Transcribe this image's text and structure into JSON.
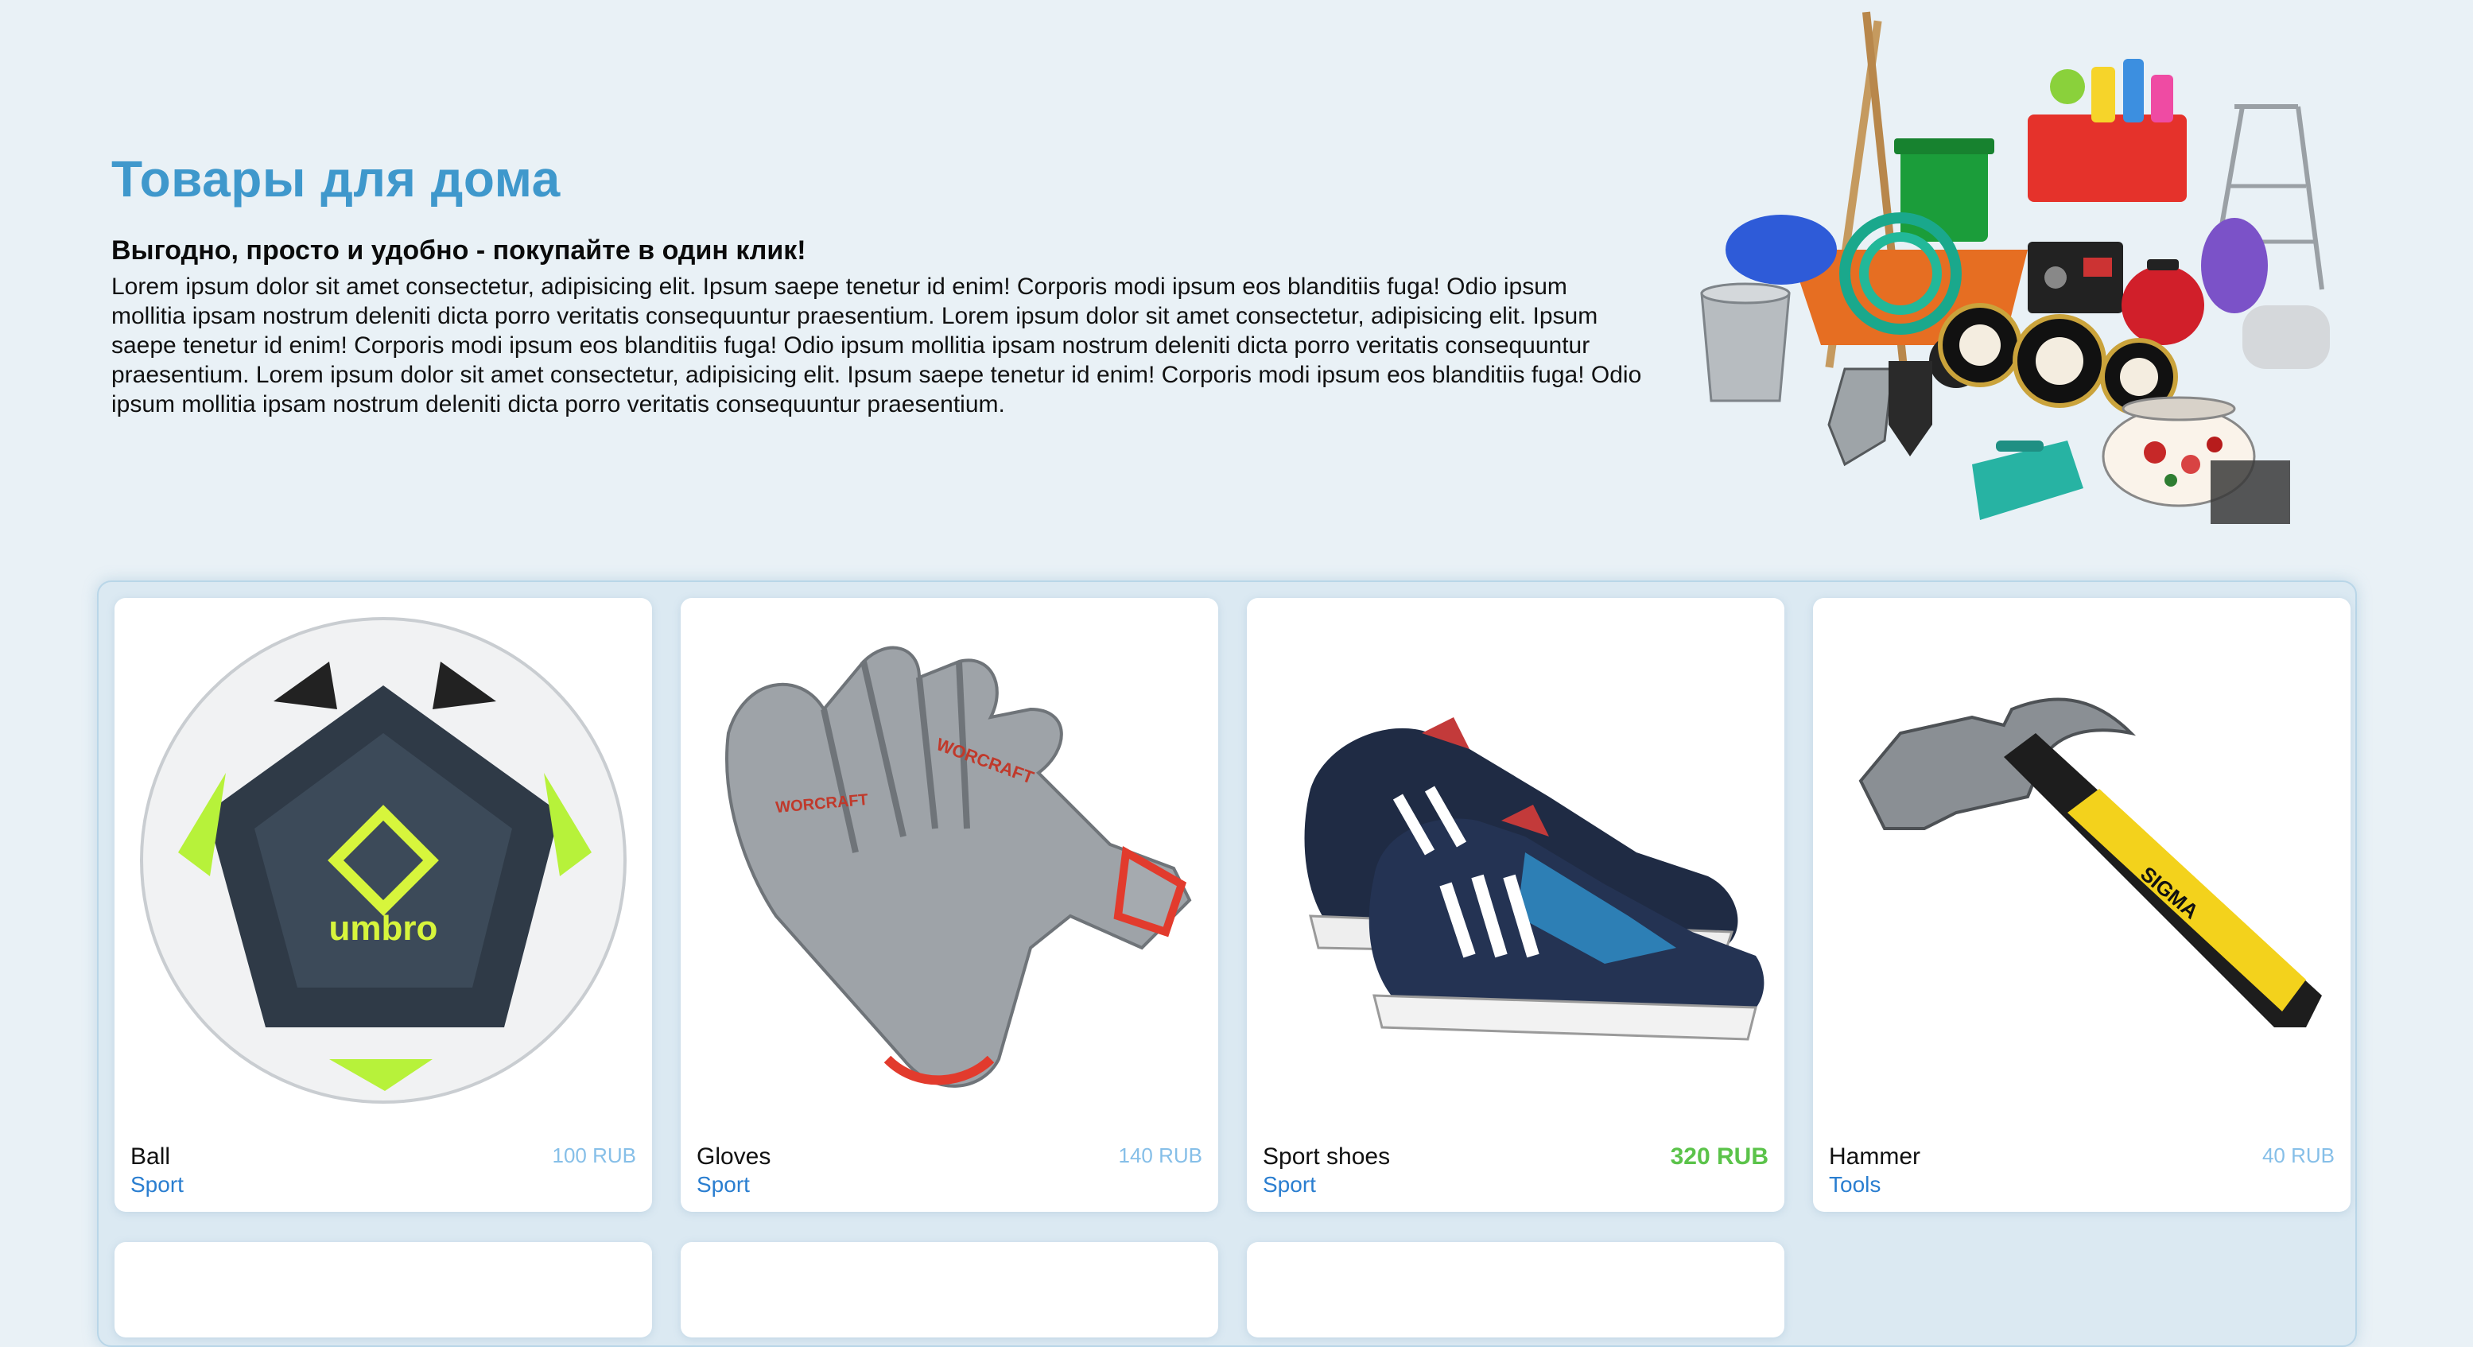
{
  "hero": {
    "title": "Товары для дома",
    "subtitle": "Выгодно, просто и удобно - покупайте в один клик!",
    "text": "Lorem ipsum dolor sit amet consectetur, adipisicing elit. Ipsum saepe tenetur id enim! Corporis modi ipsum eos blanditiis fuga! Odio ipsum mollitia ipsam nostrum deleniti dicta porro veritatis consequuntur praesentium. Lorem ipsum dolor sit amet consectetur, adipisicing elit. Ipsum saepe tenetur id enim! Corporis modi ipsum eos blanditiis fuga! Odio ipsum mollitia ipsam nostrum deleniti dicta porro veritatis consequuntur praesentium. Lorem ipsum dolor sit amet consectetur, adipisicing elit. Ipsum saepe tenetur id enim! Corporis modi ipsum eos blanditiis fuga! Odio ipsum mollitia ipsam nostrum deleniti dicta porro veritatis consequuntur praesentium.",
    "image_icon": "home-goods-illustration"
  },
  "products": [
    {
      "name": "Ball",
      "category": "Sport",
      "price": "100 RUB",
      "highlight": false,
      "icon": "soccer-ball-image"
    },
    {
      "name": "Gloves",
      "category": "Sport",
      "price": "140 RUB",
      "highlight": false,
      "icon": "gloves-image"
    },
    {
      "name": "Sport shoes",
      "category": "Sport",
      "price": "320 RUB",
      "highlight": true,
      "icon": "sneakers-image"
    },
    {
      "name": "Hammer",
      "category": "Tools",
      "price": "40 RUB",
      "highlight": false,
      "icon": "hammer-image"
    }
  ],
  "colors": {
    "title": "#3f98cc",
    "category_link": "#2a7ed0",
    "price": "#86bfe8",
    "price_highlight": "#5bc34a",
    "background": "#e9f1f6"
  }
}
